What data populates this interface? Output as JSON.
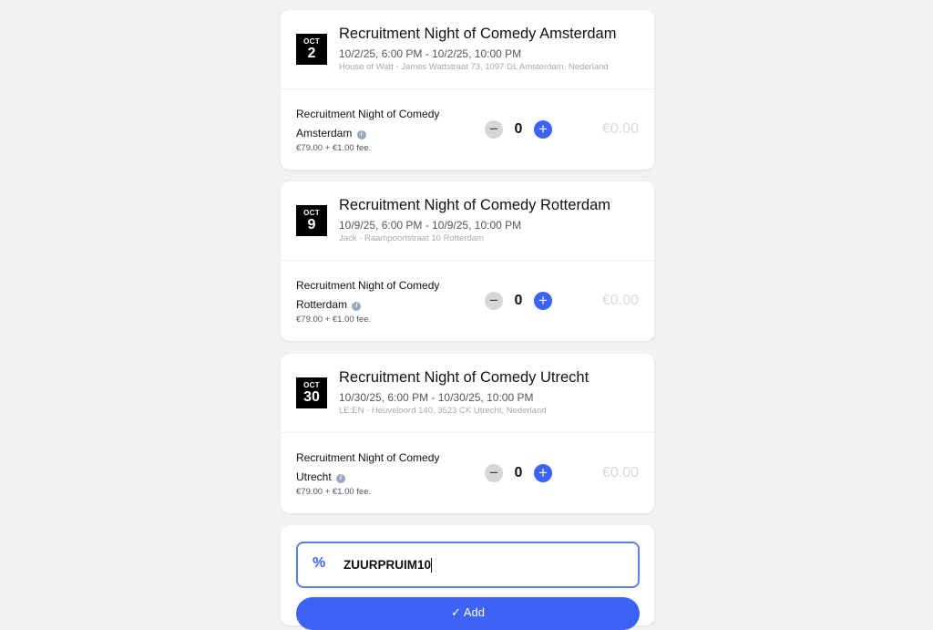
{
  "events": [
    {
      "month": "OCT",
      "day": "2",
      "title": "Recruitment Night of Comedy Amsterdam",
      "time": "10/2/25, 6:00 PM - 10/2/25, 10:00 PM",
      "location": "House of Watt - James Wattstraat 73, 1097 DL Amsterdam, Nederland",
      "ticket_name": "Recruitment Night of Comedy Amsterdam",
      "fee": "€79.00 + €1.00 fee.",
      "quantity": "0",
      "price": "€0.00"
    },
    {
      "month": "OCT",
      "day": "9",
      "title": "Recruitment Night of Comedy Rotterdam",
      "time": "10/9/25, 6:00 PM - 10/9/25, 10:00 PM",
      "location": "Jack - Raampoortstraat 10 Rotterdam",
      "ticket_name": "Recruitment Night of Comedy Rotterdam",
      "fee": "€79.00 + €1.00 fee.",
      "quantity": "0",
      "price": "€0.00"
    },
    {
      "month": "OCT",
      "day": "30",
      "title": "Recruitment Night of Comedy Utrecht",
      "time": "10/30/25, 6:00 PM - 10/30/25, 10:00 PM",
      "location": "LE:EN - Heuveloord 140, 3523 CK Utrecht, Nederland",
      "ticket_name": "Recruitment Night of Comedy Utrecht",
      "fee": "€79.00 + €1.00 fee.",
      "quantity": "0",
      "price": "€0.00"
    }
  ],
  "promo": {
    "icon": "percent-icon",
    "value": "ZUURPRUIM10",
    "add_label": "✓  Add"
  },
  "colors": {
    "accent": "#3d63f4",
    "background": "#f1f2f3"
  }
}
